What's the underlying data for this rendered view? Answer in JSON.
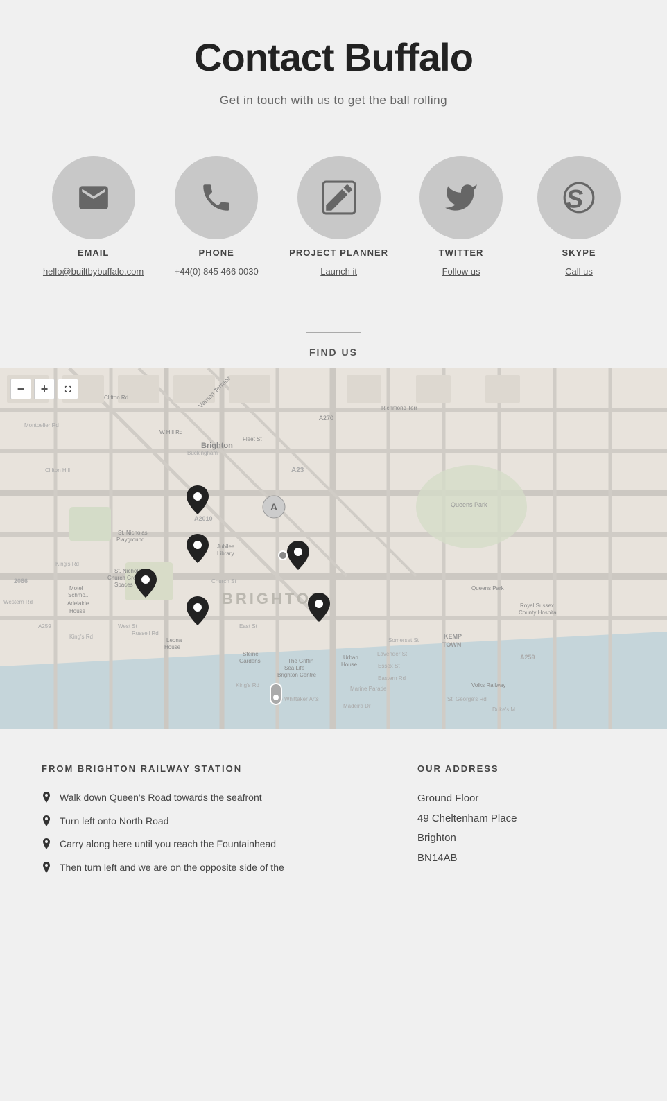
{
  "header": {
    "title": "Contact Buffalo",
    "subtitle": "Get in touch with us to get the ball rolling"
  },
  "contacts": [
    {
      "id": "email",
      "label": "EMAIL",
      "value": "hello@builtbybuffalo.com",
      "link": true,
      "icon": "email"
    },
    {
      "id": "phone",
      "label": "PHONE",
      "value": "+44(0) 845 466 0030",
      "link": false,
      "icon": "phone"
    },
    {
      "id": "project-planner",
      "label": "PROJECT PLANNER",
      "value": "Launch it",
      "link": true,
      "icon": "edit"
    },
    {
      "id": "twitter",
      "label": "TWITTER",
      "value": "Follow us",
      "link": true,
      "icon": "twitter"
    },
    {
      "id": "skype",
      "label": "SKYPE",
      "value": "Call us",
      "link": true,
      "icon": "skype"
    }
  ],
  "find_us": {
    "label": "FIND US"
  },
  "from_station": {
    "title": "FROM BRIGHTON RAILWAY STATION",
    "directions": [
      "Walk down Queen's Road towards the seafront",
      "Turn left onto North Road",
      "Carry along here until you reach the Fountainhead",
      "Then turn left and we are on the opposite side of the"
    ]
  },
  "address": {
    "title": "OUR ADDRESS",
    "lines": [
      "Ground Floor",
      "49 Cheltenham Place",
      "Brighton",
      "BN14AB"
    ]
  },
  "map": {
    "zoom_in_label": "+",
    "zoom_out_label": "−",
    "fullscreen_label": "⛶",
    "city_label": "Brighton",
    "district_label": "BRIGHTON"
  }
}
